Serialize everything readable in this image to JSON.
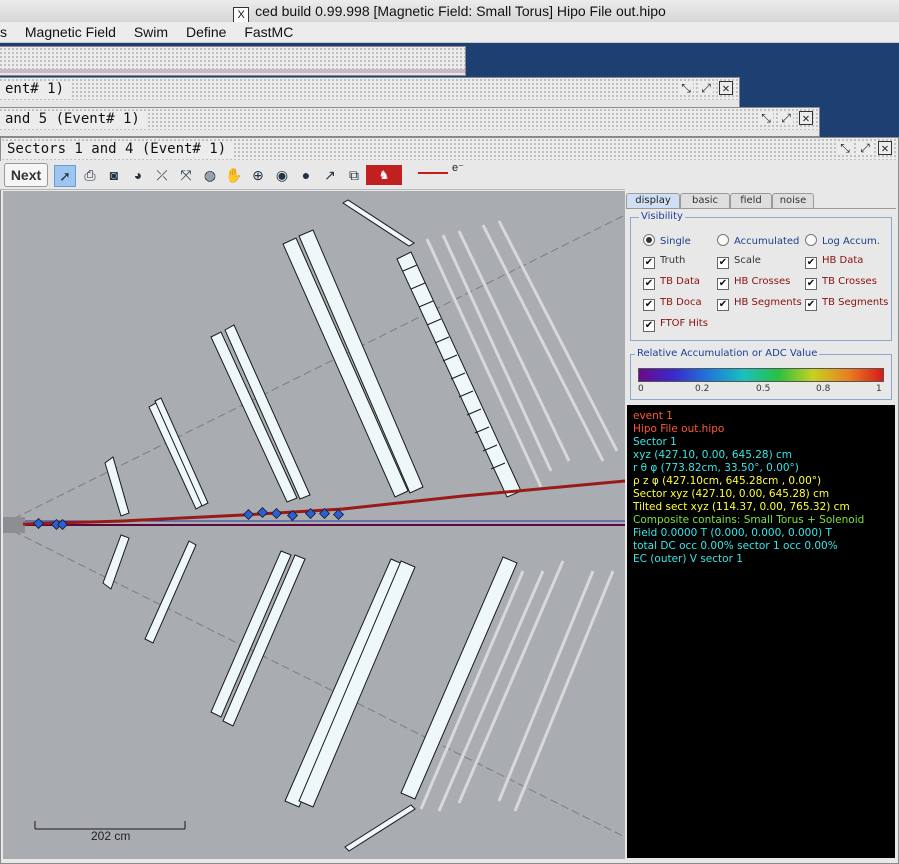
{
  "app": {
    "window_title": "ced build 0.99.998  [Magnetic Field: Small Torus]  Hipo File out.hipo",
    "x_glyph": "X"
  },
  "menubar": [
    "s",
    "Magnetic Field",
    "Swim",
    "Define",
    "FastMC"
  ],
  "frames": {
    "back2_title": "ent# 1)",
    "back1_title": "and 5  (Event# 1)",
    "front_title": "Sectors 1 and 4  (Event# 1)"
  },
  "toolbar": {
    "next_label": "Next",
    "legend_label": "e⁻",
    "legend_color": "#cc1a1a"
  },
  "canvas": {
    "scale_label": "202 cm",
    "track_color": "#9a1a1a",
    "marker_color": "#2a5fd8",
    "detector_fill": "#eef8f8"
  },
  "panel": {
    "tabs": [
      "display",
      "basic",
      "field",
      "noise"
    ],
    "active_tab": "display",
    "visibility_label": "Visibility",
    "radios": [
      {
        "label": "Single",
        "selected": true
      },
      {
        "label": "Accumulated",
        "selected": false
      },
      {
        "label": "Log Accum.",
        "selected": false
      }
    ],
    "checkboxes": [
      {
        "label": "Truth",
        "checked": true
      },
      {
        "label": "Scale",
        "checked": true
      },
      {
        "label": "HB Data",
        "checked": true
      },
      {
        "label": "TB Data",
        "checked": true
      },
      {
        "label": "HB Crosses",
        "checked": true
      },
      {
        "label": "TB Crosses",
        "checked": true
      },
      {
        "label": "TB Doca",
        "checked": true
      },
      {
        "label": "HB Segments",
        "checked": true
      },
      {
        "label": "TB Segments",
        "checked": true
      },
      {
        "label": "FTOF Hits",
        "checked": true
      }
    ],
    "check_mark": "✔",
    "accum_label": "Relative Accumulation or ADC Value",
    "gradient_ticks": [
      "0",
      "0.2",
      "0.5",
      "0.8",
      "1"
    ]
  },
  "info": {
    "lines": [
      {
        "text": "event 1",
        "color": "#ff5a36"
      },
      {
        "text": "Hipo File out.hipo",
        "color": "#ff5a36"
      },
      {
        "text": "Sector 1",
        "color": "#37e6e6"
      },
      {
        "text": "xyz (427.10, 0.00, 645.28) cm",
        "color": "#37e6e6"
      },
      {
        "text": "r θ φ (773.82cm, 33.50°, 0.00°)",
        "color": "#37e6e6"
      },
      {
        "text": "ρ z φ (427.10cm, 645.28cm , 0.00°)",
        "color": "#ffff33"
      },
      {
        "text": "Sector xyz (427.10, 0.00, 645.28) cm",
        "color": "#ffff33"
      },
      {
        "text": "Tilted sect xyz (114.37, 0.00, 765.32) cm",
        "color": "#ffff33"
      },
      {
        "text": "Composite contains: Small Torus + Solenoid",
        "color": "#7be33a"
      },
      {
        "text": "Field 0.0000 T (0.000, 0.000, 0.000) T",
        "color": "#37e6e6"
      },
      {
        "text": "total DC occ 0.00% sector 1 occ 0.00%",
        "color": "#37e6e6"
      },
      {
        "text": "EC (outer) V sector 1",
        "color": "#37e6e6"
      }
    ]
  }
}
